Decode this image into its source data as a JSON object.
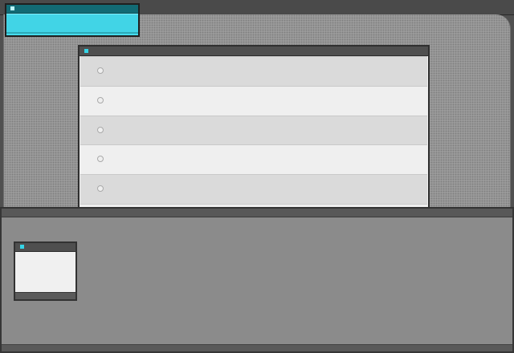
{
  "screen": {
    "title_chip": {
      "label": ""
    },
    "list_window": {
      "items": [
        {
          "label": ""
        },
        {
          "label": ""
        },
        {
          "label": ""
        },
        {
          "label": ""
        },
        {
          "label": ""
        },
        {
          "label": ""
        }
      ]
    },
    "mini_window": {
      "label": ""
    }
  },
  "colors": {
    "accent_cyan": "#45dced",
    "dark_titlebar": "#4f4f4f",
    "window_bg": "#f0f0f0",
    "desktop_gray": "#9a9a9a",
    "panel_gray": "#8b8b8b"
  }
}
